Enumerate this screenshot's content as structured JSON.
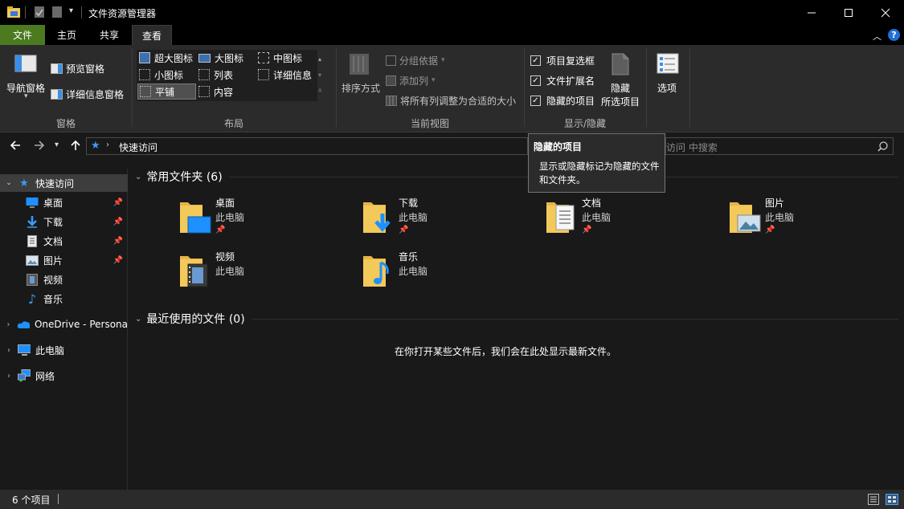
{
  "window": {
    "title": "文件资源管理器",
    "controls": [
      "minimize",
      "maximize",
      "close"
    ]
  },
  "tabs": [
    {
      "label": "文件",
      "active": false
    },
    {
      "label": "主页",
      "active": false
    },
    {
      "label": "共享",
      "active": false
    },
    {
      "label": "查看",
      "active": true
    }
  ],
  "ribbon": {
    "panes": {
      "nav_pane": "导航窗格",
      "preview_pane": "预览窗格",
      "details_pane": "详细信息窗格",
      "group_label": "窗格"
    },
    "layout": {
      "group_label": "布局",
      "items": [
        {
          "label": "超大图标"
        },
        {
          "label": "大图标"
        },
        {
          "label": "中图标"
        },
        {
          "label": "小图标"
        },
        {
          "label": "列表"
        },
        {
          "label": "详细信息"
        },
        {
          "label": "平铺",
          "selected": true
        },
        {
          "label": "内容"
        }
      ]
    },
    "current_view": {
      "group_label": "当前视图",
      "sort_by": "排序方式",
      "group_by": "分组依据",
      "add_columns": "添加列",
      "fit_columns": "将所有列调整为合适的大小"
    },
    "show_hide": {
      "group_label": "显示/隐藏",
      "item_checkboxes": {
        "label": "项目复选框",
        "checked": true
      },
      "file_extensions": {
        "label": "文件扩展名",
        "checked": true
      },
      "hidden_items": {
        "label": "隐藏的项目",
        "checked": true
      },
      "hide_selected_line1": "隐藏",
      "hide_selected_line2": "所选项目"
    },
    "options": "选项"
  },
  "address": {
    "path": "快速访问",
    "search_placeholder": "访问 中搜索"
  },
  "tooltip": {
    "title": "隐藏的项目",
    "body": "显示或隐藏标记为隐藏的文件和文件夹。"
  },
  "sidebar": {
    "quick_access": "快速访问",
    "items": [
      {
        "label": "桌面",
        "icon": "desktop-icon",
        "pinned": true
      },
      {
        "label": "下载",
        "icon": "download-icon",
        "pinned": true
      },
      {
        "label": "文档",
        "icon": "document-icon",
        "pinned": true
      },
      {
        "label": "图片",
        "icon": "picture-icon",
        "pinned": true
      },
      {
        "label": "视频",
        "icon": "video-icon",
        "pinned": false
      },
      {
        "label": "音乐",
        "icon": "music-icon",
        "pinned": false
      }
    ],
    "onedrive": "OneDrive - Persona",
    "this_pc": "此电脑",
    "network": "网络"
  },
  "content": {
    "frequent_header": "常用文件夹 (6)",
    "recent_header": "最近使用的文件 (0)",
    "recent_empty": "在你打开某些文件后，我们会在此处显示最新文件。",
    "folders": [
      {
        "name": "桌面",
        "location": "此电脑",
        "pinned": true,
        "overlay": "desktop"
      },
      {
        "name": "下载",
        "location": "此电脑",
        "pinned": true,
        "overlay": "download"
      },
      {
        "name": "文档",
        "location": "此电脑",
        "pinned": true,
        "overlay": "document"
      },
      {
        "name": "图片",
        "location": "此电脑",
        "pinned": true,
        "overlay": "picture"
      },
      {
        "name": "视频",
        "location": "此电脑",
        "pinned": false,
        "overlay": "video"
      },
      {
        "name": "音乐",
        "location": "此电脑",
        "pinned": false,
        "overlay": "music"
      }
    ]
  },
  "status": {
    "count": "6 个项目"
  },
  "colors": {
    "accent_green": "#4b7a1f",
    "folder_yellow": "#f3c959",
    "blue": "#1e90ff",
    "background": "#191919",
    "ribbon": "#2b2b2b"
  }
}
